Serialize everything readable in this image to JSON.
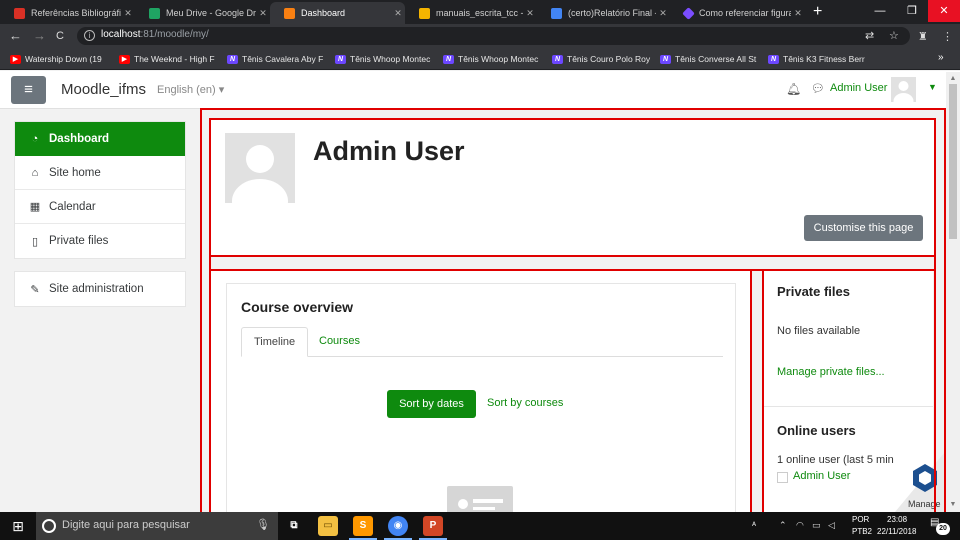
{
  "browser": {
    "tabs": [
      {
        "label": "Referências Bibliográfic",
        "icon": "gmail-icon",
        "color": "#d93025",
        "active": false
      },
      {
        "label": "Meu Drive - Google Dri",
        "icon": "drive-icon",
        "color": "#1fa463",
        "active": false
      },
      {
        "label": "Dashboard",
        "icon": "moodle-icon",
        "color": "#f98012",
        "active": true
      },
      {
        "label": "manuais_escrita_tcc - A",
        "icon": "slides-icon",
        "color": "#f4b400",
        "active": false
      },
      {
        "label": "(certo)Relatório Final - I",
        "icon": "docs-icon",
        "color": "#4285f4",
        "active": false
      },
      {
        "label": "Como referenciar figura",
        "icon": "bookmark-icon",
        "color": "#7b4dff",
        "active": false
      }
    ],
    "tab_close_glyph": "✕",
    "new_tab": "+",
    "window_controls": {
      "minimize": "—",
      "restore": "❐",
      "close": "✕"
    },
    "nav": {
      "back": "←",
      "forward": "→",
      "reload": "C"
    },
    "url_host": "localhost",
    "url_rest": ":81/moodle/my/",
    "bookmarks": [
      {
        "label": "Watership Down (19",
        "icon": "youtube-icon"
      },
      {
        "label": "The Weeknd - High F",
        "icon": "youtube-icon"
      },
      {
        "label": "Tênis Cavalera Aby F",
        "icon": "netshoes-icon"
      },
      {
        "label": "Tênis Whoop Montec",
        "icon": "netshoes-icon"
      },
      {
        "label": "Tênis Whoop Montec",
        "icon": "netshoes-icon"
      },
      {
        "label": "Tênis Couro Polo Roy",
        "icon": "netshoes-icon"
      },
      {
        "label": "Tênis Converse All St",
        "icon": "netshoes-icon"
      },
      {
        "label": "Tênis K3 Fitness Berr",
        "icon": "netshoes-icon"
      }
    ],
    "bookmarks_more": "»"
  },
  "moodle": {
    "site_name": "Moodle_ifms",
    "language": "English (en) ▾",
    "user_name": "Admin User",
    "drawer": [
      {
        "label": "Dashboard",
        "icon": "tachometer-icon",
        "glyph": "◔",
        "active": true
      },
      {
        "label": "Site home",
        "icon": "home-icon",
        "glyph": "⌂",
        "active": false
      },
      {
        "label": "Calendar",
        "icon": "calendar-icon",
        "glyph": "▦",
        "active": false
      },
      {
        "label": "Private files",
        "icon": "file-icon",
        "glyph": "▯",
        "active": false
      }
    ],
    "admin_item": {
      "label": "Site administration",
      "icon": "wrench-icon",
      "glyph": "✎"
    },
    "page_title": "Admin User",
    "customise_button": "Customise this page",
    "course_overview": {
      "title": "Course overview",
      "tabs": [
        "Timeline",
        "Courses"
      ],
      "active_tab": "Timeline",
      "sort_by_dates": "Sort by dates",
      "sort_by_courses": "Sort by courses"
    },
    "private_files_block": {
      "title": "Private files",
      "empty_text": "No files available",
      "manage_link": "Manage private files..."
    },
    "online_users_block": {
      "title": "Online users",
      "summary": "1 online user (last 5 min",
      "user": "Admin User"
    },
    "manage_badge": "Manage"
  },
  "taskbar": {
    "search_placeholder": "Digite aqui para pesquisar",
    "apps": [
      {
        "icon": "task-view-icon"
      },
      {
        "icon": "file-explorer-icon",
        "color": "#f3c042"
      },
      {
        "icon": "sublime-text-icon",
        "color": "#ff9800"
      },
      {
        "icon": "chrome-icon",
        "color": "#4285f4"
      },
      {
        "icon": "powerpoint-icon",
        "color": "#d24726"
      }
    ],
    "language": "POR",
    "layout": "PTB2",
    "time": "23:08",
    "date": "22/11/2018",
    "notifications": "20"
  },
  "colors": {
    "brand_green": "#0e8a0e",
    "annotation_red": "#e00000",
    "secondary_button": "#6c757d"
  }
}
